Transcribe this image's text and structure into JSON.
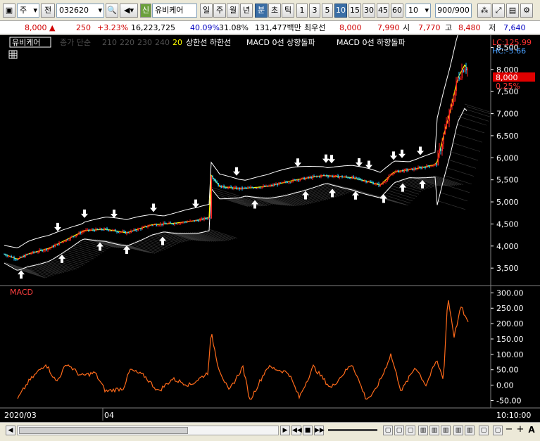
{
  "toolbar": {
    "mode_label": "주",
    "prefix_label": "전",
    "code": "032620",
    "tag": "신",
    "stock_name": "유비케어",
    "periods": [
      "일",
      "주",
      "월",
      "년"
    ],
    "intraday": [
      "분",
      "초",
      "틱"
    ],
    "intervals": [
      "1",
      "3",
      "5",
      "10",
      "15",
      "30",
      "45",
      "60"
    ],
    "active_interval": "10",
    "unit_value": "10",
    "count_value": "900/900"
  },
  "quote": {
    "price": "8,000",
    "change_arrow": "▲",
    "change": "250",
    "change_pct": "+3.23%",
    "volume": "16,223,725",
    "ratio1": "40.09%",
    "ratio2": "31.08%",
    "amount": "131,477백만",
    "best_label": "최우선",
    "best_ask": "8,000",
    "best_bid": "7,990",
    "open_label": "시",
    "open": "7,770",
    "high_label": "고",
    "high": "8,480",
    "low_label": "저",
    "low": "7,640"
  },
  "legend": {
    "name": "유비케어",
    "ma_label": "종가 단순",
    "ma_periods": [
      "210",
      "220",
      "230",
      "240",
      "20"
    ],
    "upper_lower": "상한선  하한선",
    "macd_up": "MACD 0선 상향돌파",
    "macd_down": "MACD 0선 하향돌파"
  },
  "price_axis": {
    "ticks": [
      "8,500",
      "8,000",
      "7,500",
      "7,000",
      "6,500",
      "6,000",
      "5,500",
      "5,000",
      "4,500",
      "4,000",
      "3,500"
    ],
    "lc_label": "LC:125.99",
    "hc_label": "HC:-5.66",
    "current_price": "8,000",
    "current_pct": "0.25%"
  },
  "macd_panel": {
    "title": "MACD",
    "ticks": [
      "300.00",
      "250.00",
      "200.00",
      "150.00",
      "100.00",
      "50.00",
      "0.00",
      "-50.00"
    ]
  },
  "time_axis": {
    "start": "2020/03",
    "mid": "04",
    "clock": "10:10:00"
  },
  "chart_data": {
    "type": "candlestick",
    "price_range": [
      3200,
      8650
    ],
    "macd_range": [
      -65,
      310
    ],
    "price_path": [
      [
        0,
        3850
      ],
      [
        25,
        3700
      ],
      [
        40,
        3820
      ],
      [
        70,
        3950
      ],
      [
        95,
        4150
      ],
      [
        120,
        4350
      ],
      [
        150,
        4380
      ],
      [
        180,
        4300
      ],
      [
        215,
        4480
      ],
      [
        250,
        4520
      ],
      [
        280,
        4580
      ],
      [
        298,
        4650
      ],
      [
        300,
        5600
      ],
      [
        312,
        5350
      ],
      [
        340,
        5300
      ],
      [
        380,
        5350
      ],
      [
        420,
        5500
      ],
      [
        460,
        5600
      ],
      [
        500,
        5550
      ],
      [
        525,
        5450
      ],
      [
        540,
        5380
      ],
      [
        560,
        5680
      ],
      [
        590,
        5750
      ],
      [
        620,
        5850
      ],
      [
        630,
        6500
      ],
      [
        640,
        7100
      ],
      [
        650,
        7800
      ],
      [
        660,
        8100
      ],
      [
        665,
        8000
      ]
    ],
    "macd_path": [
      [
        25,
        -45
      ],
      [
        40,
        10
      ],
      [
        65,
        70
      ],
      [
        80,
        10
      ],
      [
        95,
        70
      ],
      [
        115,
        30
      ],
      [
        135,
        40
      ],
      [
        150,
        -20
      ],
      [
        175,
        -10
      ],
      [
        185,
        50
      ],
      [
        205,
        30
      ],
      [
        225,
        -20
      ],
      [
        245,
        20
      ],
      [
        270,
        0
      ],
      [
        295,
        40
      ],
      [
        300,
        170
      ],
      [
        310,
        60
      ],
      [
        325,
        -20
      ],
      [
        345,
        60
      ],
      [
        355,
        -50
      ],
      [
        380,
        60
      ],
      [
        410,
        40
      ],
      [
        425,
        -40
      ],
      [
        445,
        60
      ],
      [
        470,
        -10
      ],
      [
        500,
        70
      ],
      [
        520,
        -45
      ],
      [
        530,
        -30
      ],
      [
        545,
        40
      ],
      [
        555,
        100
      ],
      [
        570,
        -20
      ],
      [
        590,
        60
      ],
      [
        605,
        0
      ],
      [
        620,
        80
      ],
      [
        630,
        20
      ],
      [
        636,
        290
      ],
      [
        645,
        160
      ],
      [
        655,
        255
      ],
      [
        665,
        200
      ]
    ],
    "buy_signals_x": [
      30,
      88,
      142,
      180,
      231,
      362,
      434,
      472,
      505,
      545,
      572,
      600
    ],
    "sell_signals_x": [
      82,
      120,
      162,
      218,
      278,
      336,
      423,
      463,
      471,
      510,
      524,
      559,
      571,
      597
    ]
  }
}
